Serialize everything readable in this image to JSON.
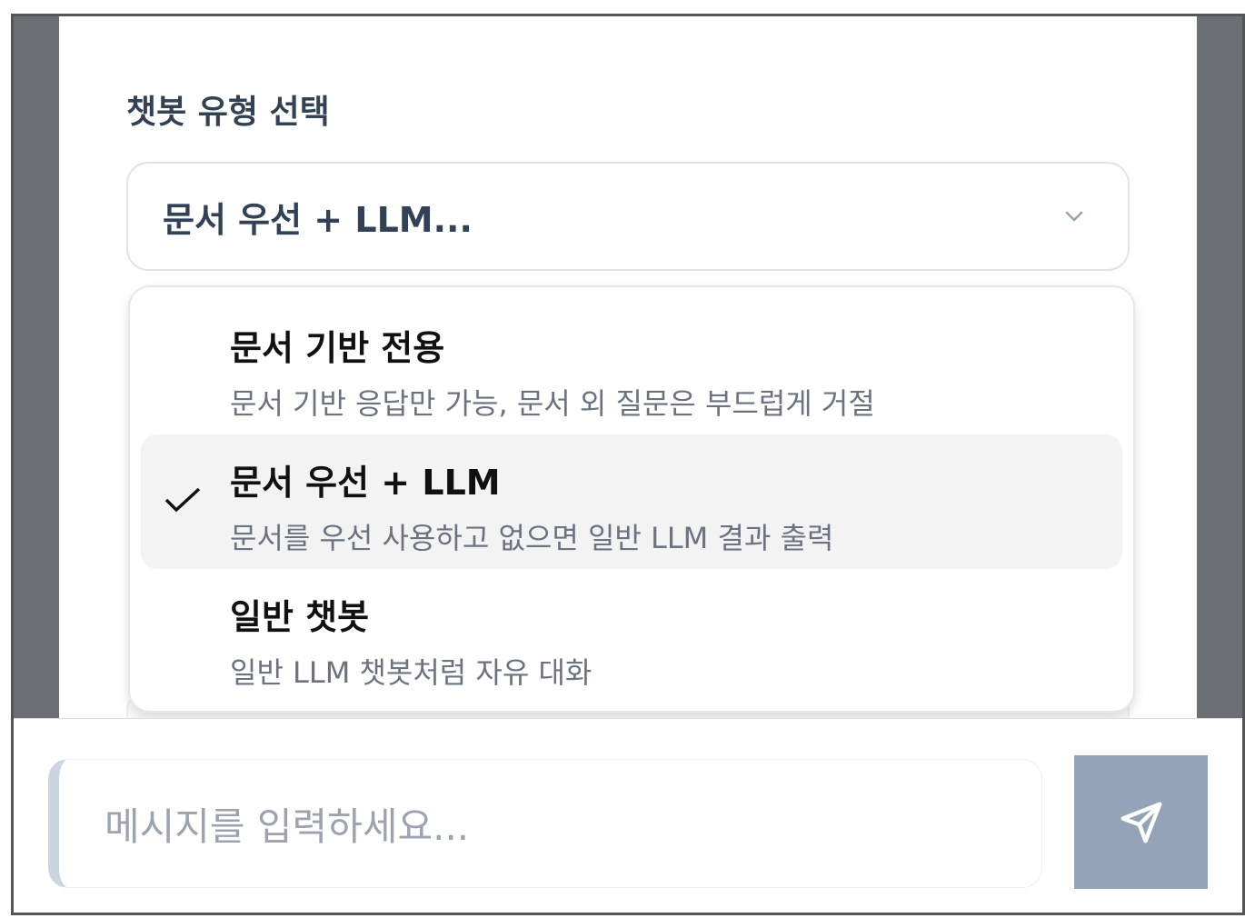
{
  "section_title": "챗봇 유형 선택",
  "select": {
    "value": "문서 우선 + LLM..."
  },
  "options": [
    {
      "label": "문서 기반 전용",
      "desc": "문서 기반 응답만 가능, 문서 외 질문은 부드럽게 거절",
      "selected": false
    },
    {
      "label": "문서 우선 + LLM",
      "desc": "문서를 우선 사용하고 없으면 일반 LLM 결과 출력",
      "selected": true
    },
    {
      "label": "일반 챗봇",
      "desc": "일반 LLM 챗봇처럼 자유 대화",
      "selected": false
    }
  ],
  "composer": {
    "placeholder": "메시지를 입력하세요..."
  }
}
